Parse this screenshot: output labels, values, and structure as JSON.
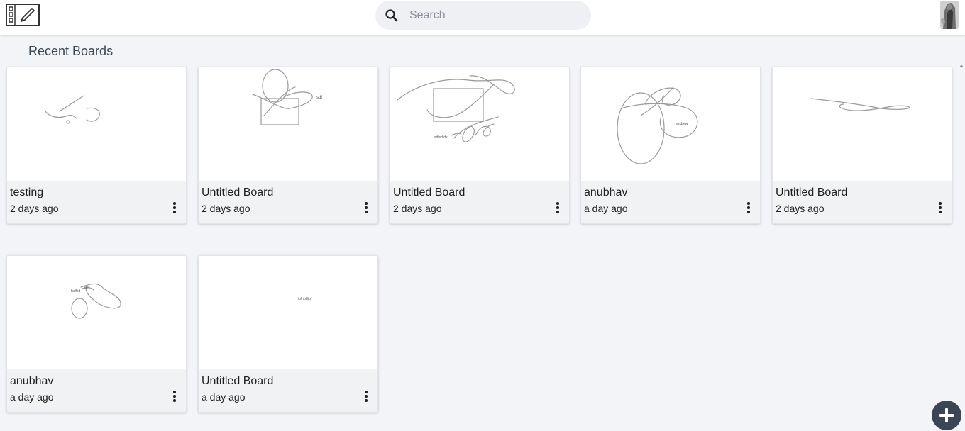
{
  "search": {
    "placeholder": "Search"
  },
  "section": {
    "title": "Recent Boards"
  },
  "boards": [
    {
      "title": "testing",
      "time": "2 days ago"
    },
    {
      "title": "Untitled Board",
      "time": "2 days ago"
    },
    {
      "title": "Untitled Board",
      "time": "2 days ago"
    },
    {
      "title": "anubhav",
      "time": "a day ago"
    },
    {
      "title": "Untitled Board",
      "time": "2 days ago"
    },
    {
      "title": "anubhav",
      "time": "a day ago"
    },
    {
      "title": "Untitled Board",
      "time": "a day ago"
    }
  ],
  "thumb_texts": {
    "b2": "sdf",
    "b3": "sdfsdfds",
    "b4": "andrew",
    "b6a": "fsdfsd",
    "b6b": "sdf",
    "b7": "ipfholjlipf"
  },
  "colors": {
    "accent": "#3c4553",
    "page_bg": "#f2f4f7"
  }
}
